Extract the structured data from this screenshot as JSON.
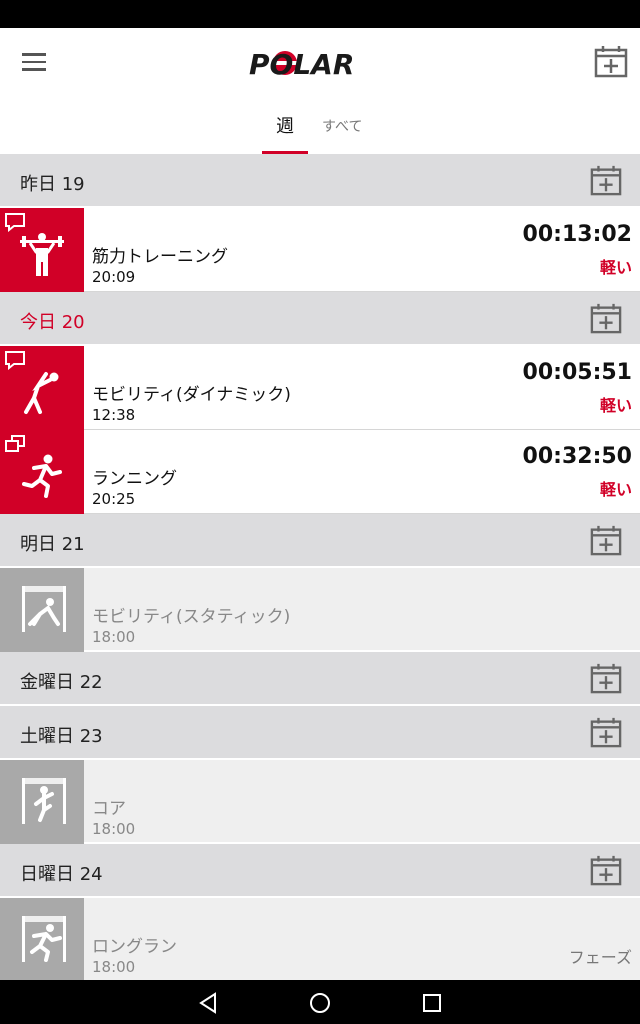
{
  "app": {
    "logo_text": "POLAR"
  },
  "tabs": [
    {
      "label": "週",
      "selected": true
    },
    {
      "label": "すべて",
      "selected": false
    }
  ],
  "days": [
    {
      "label": "昨日 19",
      "today": false
    },
    {
      "label": "今日 20",
      "today": true
    },
    {
      "label": "明日 21",
      "today": false
    },
    {
      "label": "金曜日 22",
      "today": false
    },
    {
      "label": "土曜日 23",
      "today": false
    },
    {
      "label": "日曜日 24",
      "today": false
    }
  ],
  "sessions": [
    {
      "name": "筋力トレーニング",
      "time": "20:09",
      "duration": "00:13:02",
      "intensity": "軽い",
      "icon": "strength-training-icon",
      "badge": "comment-icon"
    },
    {
      "name": "モビリティ(ダイナミック)",
      "time": "12:38",
      "duration": "00:05:51",
      "intensity": "軽い",
      "icon": "mobility-dynamic-icon",
      "badge": "comment-icon"
    },
    {
      "name": "ランニング",
      "time": "20:25",
      "duration": "00:32:50",
      "intensity": "軽い",
      "icon": "running-icon",
      "badge": "multi-copy-icon"
    },
    {
      "name": "モビリティ(スタティック)",
      "time": "18:00",
      "icon": "mobility-static-icon",
      "planned": true
    },
    {
      "name": "コア",
      "time": "18:00",
      "icon": "core-icon",
      "planned": true
    },
    {
      "name": "ロングラン",
      "time": "18:00",
      "phase": "フェーズ",
      "icon": "long-run-icon",
      "planned": true
    }
  ],
  "colors": {
    "accent": "#d10027",
    "header_bg": "#dcdcde",
    "planned_bg": "#efefef"
  }
}
